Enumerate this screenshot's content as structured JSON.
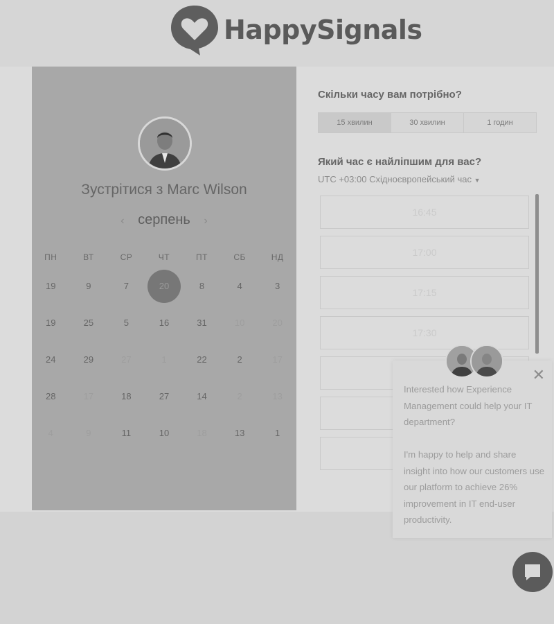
{
  "brand": {
    "name": "HappySignals"
  },
  "booking": {
    "title": "Зустрітися з Marc Wilson",
    "month": "серпень",
    "weekdays": [
      "ПН",
      "ВТ",
      "СР",
      "ЧТ",
      "ПТ",
      "СБ",
      "НД"
    ],
    "calendar_rows": [
      [
        {
          "d": "19",
          "dim": false
        },
        {
          "d": "9",
          "dim": false
        },
        {
          "d": "7",
          "dim": false
        },
        {
          "d": "20",
          "dim": false,
          "selected": true
        },
        {
          "d": "8",
          "dim": false
        },
        {
          "d": "4",
          "dim": false
        },
        {
          "d": "3",
          "dim": false
        }
      ],
      [
        {
          "d": "19",
          "dim": false
        },
        {
          "d": "25",
          "dim": false
        },
        {
          "d": "5",
          "dim": false
        },
        {
          "d": "16",
          "dim": false
        },
        {
          "d": "31",
          "dim": false
        },
        {
          "d": "10",
          "dim": true
        },
        {
          "d": "20",
          "dim": true
        }
      ],
      [
        {
          "d": "24",
          "dim": false
        },
        {
          "d": "29",
          "dim": false
        },
        {
          "d": "27",
          "dim": true
        },
        {
          "d": "1",
          "dim": true
        },
        {
          "d": "22",
          "dim": false
        },
        {
          "d": "2",
          "dim": false
        },
        {
          "d": "17",
          "dim": true
        }
      ],
      [
        {
          "d": "28",
          "dim": false
        },
        {
          "d": "17",
          "dim": true
        },
        {
          "d": "18",
          "dim": false
        },
        {
          "d": "27",
          "dim": false
        },
        {
          "d": "14",
          "dim": false
        },
        {
          "d": "2",
          "dim": true
        },
        {
          "d": "13",
          "dim": true
        }
      ],
      [
        {
          "d": "4",
          "dim": true
        },
        {
          "d": "9",
          "dim": true
        },
        {
          "d": "11",
          "dim": false
        },
        {
          "d": "10",
          "dim": false
        },
        {
          "d": "18",
          "dim": true
        },
        {
          "d": "13",
          "dim": false
        },
        {
          "d": "1",
          "dim": false
        }
      ]
    ],
    "duration_question": "Скільки часу вам потрібно?",
    "durations": [
      {
        "label": "15 хвилин",
        "active": true
      },
      {
        "label": "30 хвилин",
        "active": false
      },
      {
        "label": "1 годин",
        "active": false
      }
    ],
    "time_question": "Який час є найліпшим для вас?",
    "timezone": "UTC +03:00 Східноєвропейський час",
    "slots": [
      "16:45",
      "17:00",
      "17:15",
      "17:30",
      "",
      "",
      ""
    ]
  },
  "popup": {
    "text1": "Interested how Experience Management could help your IT department?",
    "text2": "I'm happy to help and share insight into how our customers use our platform to achieve 26% improvement in IT end-user productivity."
  }
}
